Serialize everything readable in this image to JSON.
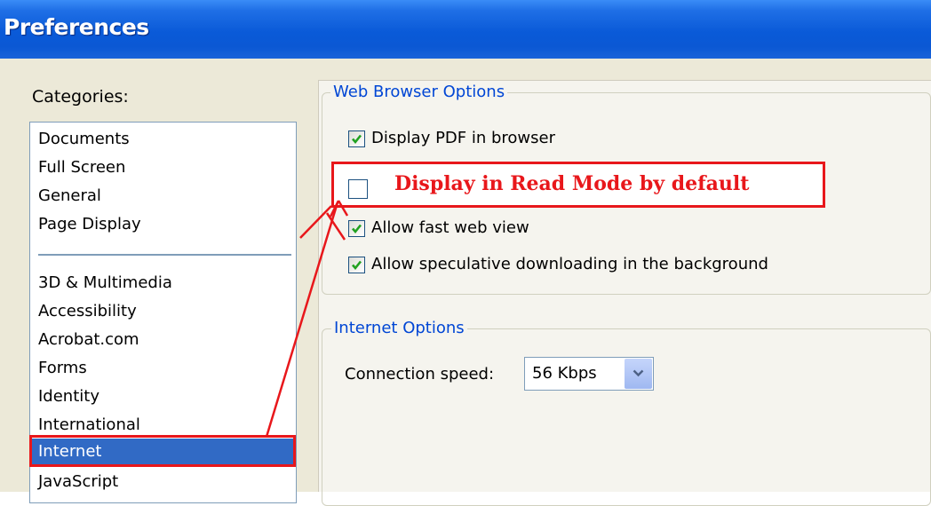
{
  "window": {
    "title": "Preferences"
  },
  "categories": {
    "label": "Categories:",
    "group1": [
      "Documents",
      "Full Screen",
      "General",
      "Page Display"
    ],
    "group2": [
      "3D & Multimedia",
      "Accessibility",
      "Acrobat.com",
      "Forms",
      "Identity",
      "International",
      "Internet",
      "JavaScript"
    ],
    "selected": "Internet"
  },
  "web_browser_options": {
    "title": "Web Browser Options",
    "display_pdf": {
      "label": "Display PDF in browser",
      "checked": true
    },
    "read_mode": {
      "label": "Display in Read Mode by default",
      "checked": false
    },
    "fast_web_view": {
      "label": "Allow fast web view",
      "checked": true
    },
    "speculative_download": {
      "label": "Allow speculative downloading in the background",
      "checked": true
    }
  },
  "internet_options": {
    "title": "Internet Options",
    "connection_speed_label": "Connection speed:",
    "connection_speed_value": "56 Kbps"
  },
  "colors": {
    "annotation_red": "#e8171b",
    "selection_blue": "#316ac5",
    "group_title_blue": "#0046d5",
    "checkmark_green": "#21a121"
  }
}
